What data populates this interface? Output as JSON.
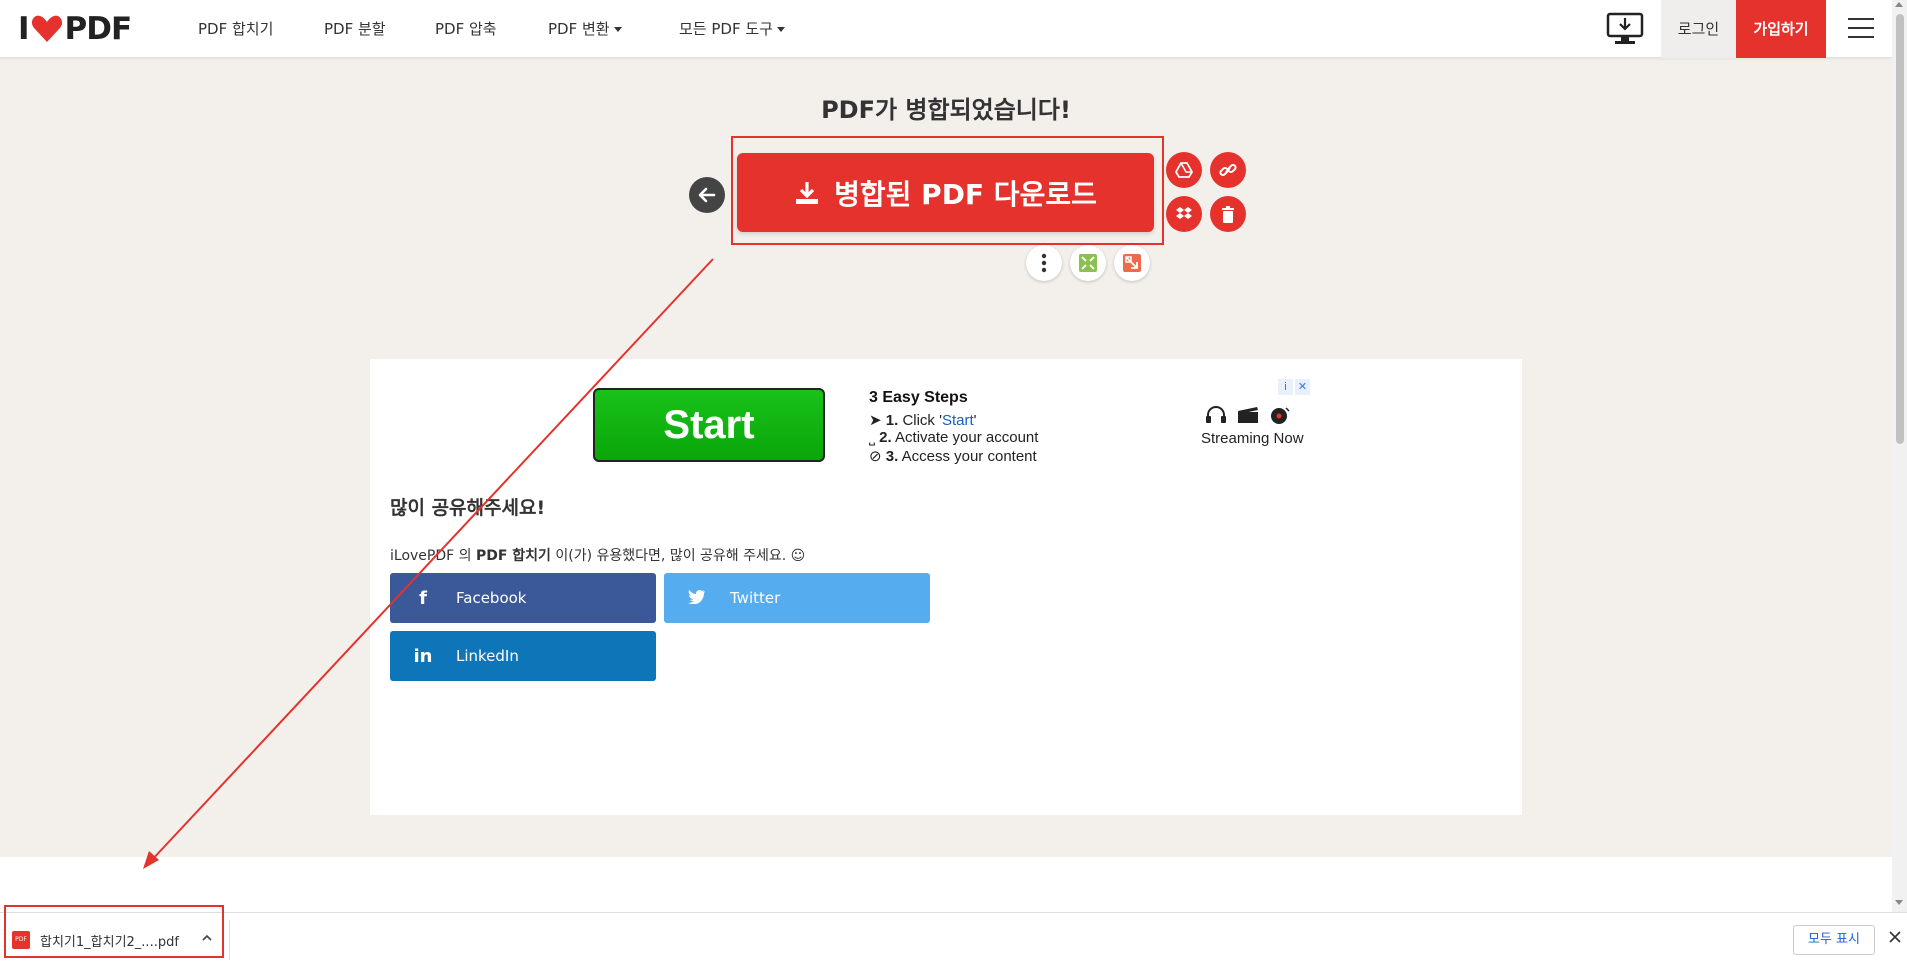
{
  "nav": {
    "logo_left": "I",
    "logo_right": "PDF",
    "items": [
      "PDF 합치기",
      "PDF 분할",
      "PDF 압축",
      "PDF 변환",
      "모든 PDF 도구"
    ],
    "login": "로그인",
    "signup": "가입하기"
  },
  "result": {
    "title": "PDF가 병합되었습니다!",
    "download_label": "병합된 PDF 다운로드"
  },
  "ad": {
    "start_label": "Start",
    "steps_title": "3 Easy Steps",
    "step1_num": "1.",
    "step1_text": "Click '",
    "step1_link": "Start",
    "step1_end": "'",
    "step2_num": "2.",
    "step2_text": "Activate your account",
    "step3_num": "3.",
    "step3_text": "Access your content",
    "streaming": "Streaming Now",
    "info_glyph": "i",
    "close_glyph": "✕"
  },
  "share": {
    "title": "많이 공유해주세요!",
    "desc_pre": "iLovePDF 의 ",
    "desc_tool": "PDF 합치기",
    "desc_post": " 이(가) 유용했다면, 많이 공유해 주세요. ☺",
    "facebook": "Facebook",
    "twitter": "Twitter",
    "linkedin": "LinkedIn",
    "facebook_color": "#3b5998",
    "twitter_color": "#55acee",
    "linkedin_color": "#0e76b8"
  },
  "download_shelf": {
    "filename": "합치기1_합치기2_....pdf",
    "file_icon": "PDF",
    "show_all": "모두 표시"
  },
  "colors": {
    "brand_red": "#e5322d"
  }
}
